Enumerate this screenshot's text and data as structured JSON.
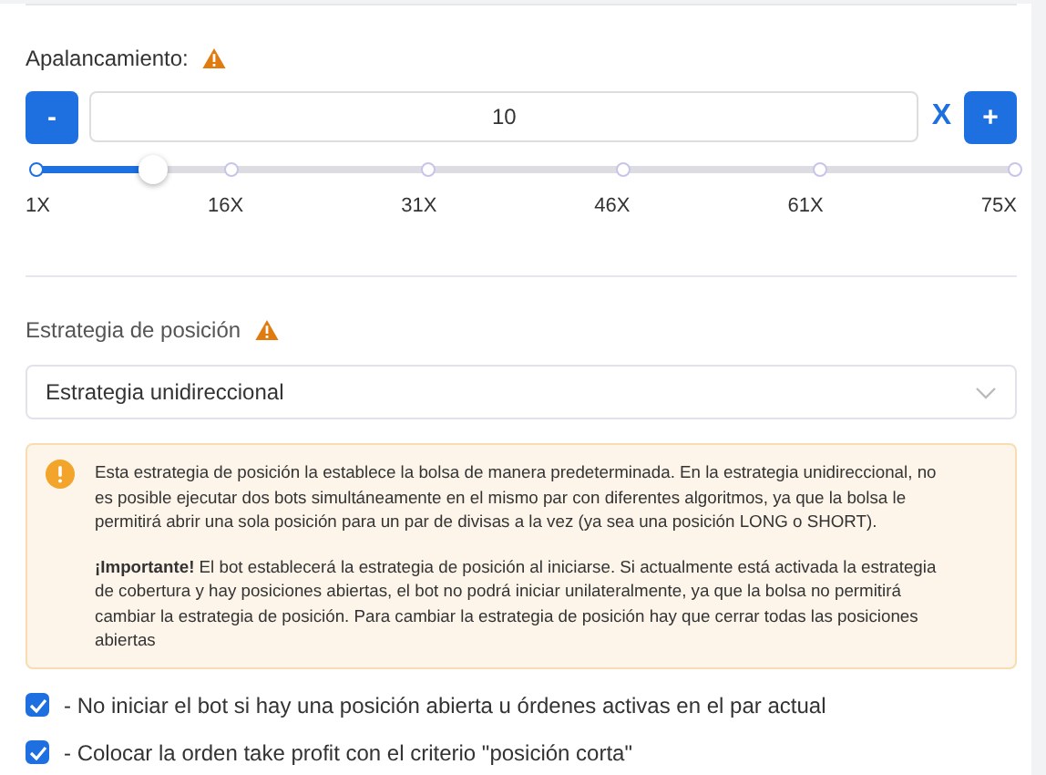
{
  "leverage": {
    "label": "Apalancamiento:",
    "minus": "-",
    "value": "10",
    "unit": "X",
    "plus": "+",
    "level": 0.12,
    "ticks": [
      "1X",
      "16X",
      "31X",
      "46X",
      "61X",
      "75X"
    ]
  },
  "position_strategy": {
    "label": "Estrategia de posición",
    "value": "Estrategia unidireccional",
    "alert": [
      "Esta estrategia de posición la establece la bolsa de manera predeterminada. En la estrategia unidireccional, no es posible ejecutar dos bots simultáneamente en el mismo par con diferentes algoritmos, ya que la bolsa le permitirá abrir una sola posición para un par de divisas a la vez (ya sea una posición LONG o SHORT).",
      "**¡Importante!** El bot establecerá la estrategia de posición al iniciarse. Si actualmente está activada la estrategia de cobertura y hay posiciones abiertas, el bot no podrá iniciar unilateralmente, ya que la bolsa no permitirá cambiar la estrategia de posición. Para cambiar la estrategia de posición hay que cerrar todas las posiciones abiertas"
    ]
  },
  "options": [
    {
      "label": "- No iniciar el bot si hay una posición abierta u órdenes activas en el par actual",
      "checked": true
    },
    {
      "label": "- Colocar la orden take profit con el criterio \"posición corta\"",
      "checked": true
    }
  ]
}
